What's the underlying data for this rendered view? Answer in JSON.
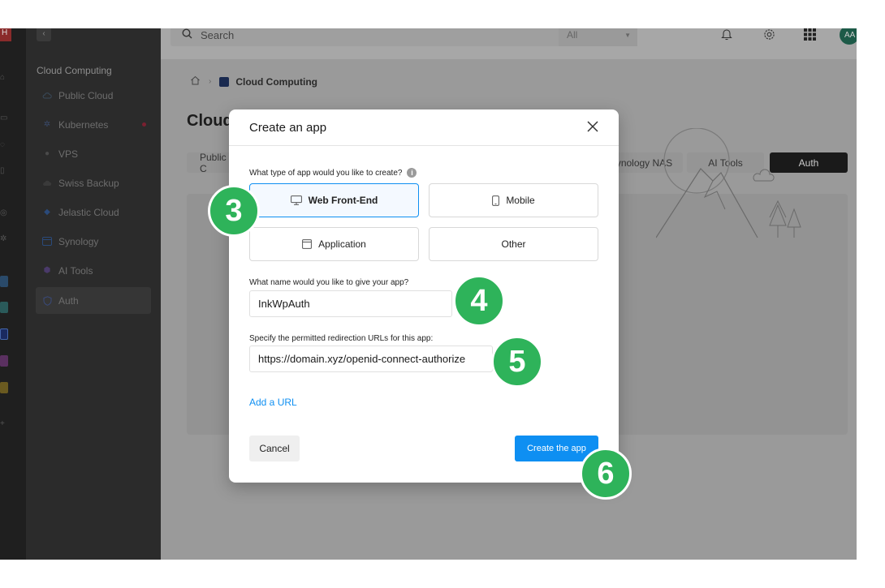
{
  "topbar": {
    "search_placeholder": "Search",
    "filter_value": "All",
    "avatar_initials": "AA"
  },
  "rail": {
    "logo_text": "H"
  },
  "sidebar": {
    "section_title": "Cloud Computing",
    "items": [
      {
        "label": "Public Cloud",
        "icon": "cloud-icon"
      },
      {
        "label": "Kubernetes",
        "icon": "kubernetes-icon",
        "badge": true
      },
      {
        "label": "VPS",
        "icon": "vps-icon"
      },
      {
        "label": "Swiss Backup",
        "icon": "backup-cloud-icon"
      },
      {
        "label": "Jelastic Cloud",
        "icon": "jelastic-icon"
      },
      {
        "label": "Synology",
        "icon": "synology-icon"
      },
      {
        "label": "AI Tools",
        "icon": "ai-tools-icon"
      },
      {
        "label": "Auth",
        "icon": "shield-icon",
        "active": true
      }
    ]
  },
  "breadcrumb": {
    "current": "Cloud Computing"
  },
  "page": {
    "title": "Cloud"
  },
  "tabs": [
    {
      "label": "Public C",
      "active": false
    },
    {
      "label": "ynology NAS",
      "active": false
    },
    {
      "label": "AI Tools",
      "active": false
    },
    {
      "label": "Auth",
      "active": true
    }
  ],
  "modal": {
    "title": "Create an app",
    "question_type": "What type of app would you like to create?",
    "app_types": [
      {
        "label": "Web Front-End",
        "icon": "monitor-icon",
        "selected": true
      },
      {
        "label": "Mobile",
        "icon": "mobile-icon",
        "selected": false
      },
      {
        "label": "Application",
        "icon": "window-icon",
        "selected": false
      },
      {
        "label": "Other",
        "icon": "",
        "selected": false
      }
    ],
    "question_name": "What name would you like to give your app?",
    "app_name_value": "InkWpAuth",
    "question_urls": "Specify the permitted redirection URLs for this app:",
    "redirect_url_value": "https://domain.xyz/openid-connect-authorize",
    "add_url_label": "Add a URL",
    "cancel_label": "Cancel",
    "create_label": "Create the app"
  },
  "step_markers": [
    "3",
    "4",
    "5",
    "6"
  ],
  "colors": {
    "accent": "#0e8ff2",
    "step_badge": "#2eb35a",
    "overlay_dim": "#9a9a9a"
  }
}
